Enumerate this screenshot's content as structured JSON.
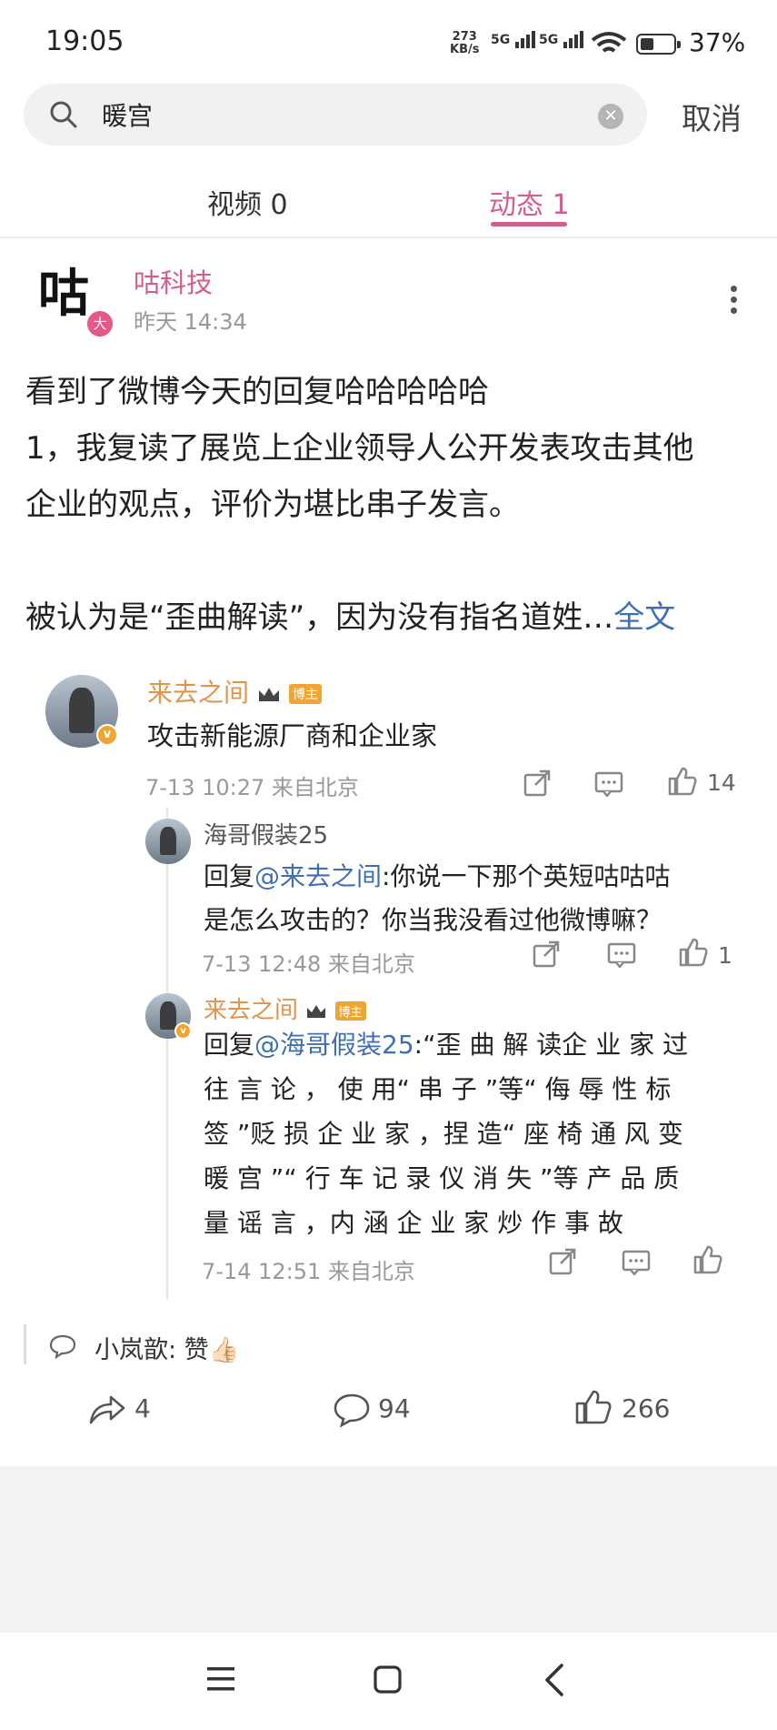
{
  "status_bar": {
    "time": "19:05",
    "net_speed": "273",
    "net_unit": "KB/s",
    "sig1": "5G",
    "sig2": "5G",
    "battery": "37%"
  },
  "search": {
    "query": "暖宫",
    "cancel_label": "取消"
  },
  "tabs": [
    {
      "label": "视频 0",
      "active": false
    },
    {
      "label": "动态 1",
      "active": true
    }
  ],
  "post": {
    "author_avatar_char": "咕",
    "author_badge": "大",
    "author": "咕科技",
    "time": "昨天 14:34",
    "lines": [
      "看到了微博今天的回复哈哈哈哈哈",
      "1，我复读了展览上企业领导人公开发表攻击其他",
      "企业的观点，评价为堪比串子发言。",
      "",
      "被认为是“歪曲解读”，因为没有指名道姓…"
    ],
    "full_text_link": "全文"
  },
  "comments": [
    {
      "user": "来去之间",
      "badge": "博主",
      "text": "攻击新能源厂商和企业家",
      "meta": "7-13 10:27  来自北京",
      "likes": "14",
      "replies": [
        {
          "user": "海哥假装25",
          "reply_prefix": "回复",
          "mention": "@来去之间",
          "text_lines": [
            ":你说一下那个英短咕咕咕",
            "是怎么攻击的？你当我没看过他微博嘛？"
          ],
          "meta": "7-13 12:48  来自北京",
          "likes": "1"
        },
        {
          "user": "来去之间",
          "badge": "博主",
          "reply_prefix": "回复",
          "mention": "@海哥假装25",
          "text_lines": [
            ":“歪 曲 解 读企 业 家 过",
            "往 言 论 ， 使 用“ 串 子 ”等“ 侮 辱 性 标",
            "签 ”贬 损 企 业 家 ，捏 造“ 座 椅 通 风 变",
            "暖 宫 ”“ 行 车 记 录 仪 消 失 ”等 产 品 质",
            "量 谣 言 ，内 涵 企 业 家 炒 作 事 故"
          ],
          "meta": "7-14 12:51  来自北京",
          "likes": ""
        }
      ]
    }
  ],
  "footer_comment": {
    "user": "小岚歆",
    "text": ": 赞👍🏻"
  },
  "actions": {
    "share_count": "4",
    "comment_count": "94",
    "like_count": "266"
  },
  "icons": {
    "search": "search-icon",
    "clear": "clear-icon",
    "more": "more-vertical-icon",
    "share": "share-arrow-icon",
    "comment": "comment-bubble-icon",
    "like": "thumbs-up-icon"
  }
}
